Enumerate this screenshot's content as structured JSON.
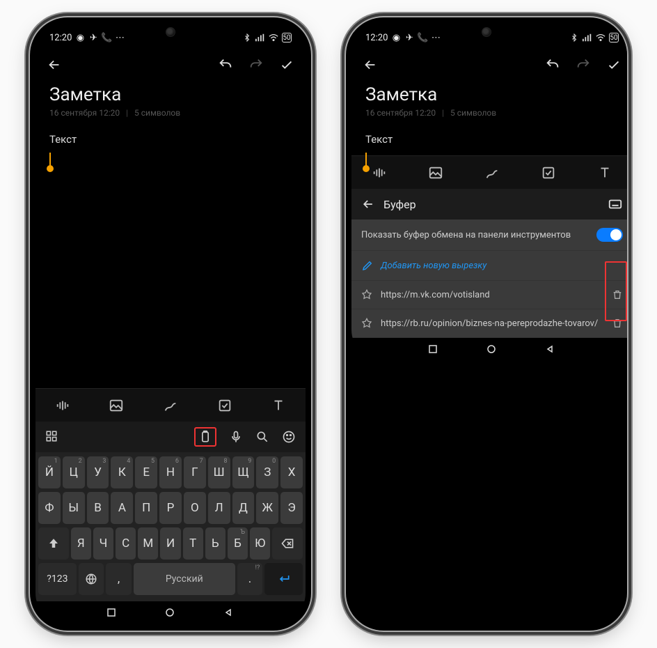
{
  "status": {
    "time": "12:20",
    "battery": "50"
  },
  "appbar": {},
  "note": {
    "title": "Заметка",
    "date": "16 сентября 12:20",
    "chars": "5 символов",
    "content": "Текст"
  },
  "keyboard": {
    "lang_label": "Русский",
    "symbols_label": "?123",
    "row1": [
      "Й",
      "Ц",
      "У",
      "К",
      "Е",
      "Н",
      "Г",
      "Ш",
      "Щ",
      "З",
      "Х"
    ],
    "row1_tiny": [
      "1",
      "2",
      "3",
      "4",
      "5",
      "6",
      "7",
      "8",
      "9",
      "0",
      ""
    ],
    "row2": [
      "Ф",
      "Ы",
      "В",
      "А",
      "П",
      "Р",
      "О",
      "Л",
      "Д",
      "Ж",
      "Э"
    ],
    "row3_letters": [
      "Я",
      "Ч",
      "С",
      "М",
      "И",
      "Т",
      "Ь",
      "Б",
      "Ю"
    ],
    "row3_tiny_last": "Ъ"
  },
  "clipboard": {
    "title": "Буфер",
    "toggle_label": "Показать буфер обмена на панели инструментов",
    "add_label": "Добавить новую вырезку",
    "items": [
      {
        "text": "https://m.vk.com/votisland"
      },
      {
        "text": "https://rb.ru/opinion/biznes-na-pereprodazhe-tovarov/"
      }
    ]
  }
}
